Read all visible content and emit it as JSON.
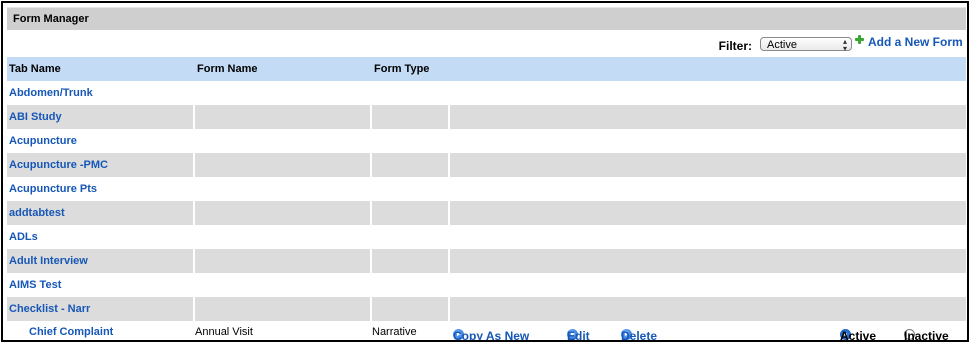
{
  "panel": {
    "title": "Form Manager"
  },
  "filter": {
    "label": "Filter:",
    "selected": "Active",
    "add_label": "Add a New Form"
  },
  "table": {
    "headers": [
      "Tab Name",
      "Form Name",
      "Form Type",
      ""
    ],
    "tabs": [
      "Abdomen/Trunk",
      "ABI Study",
      "Acupuncture",
      "Acupuncture -PMC",
      "Acupuncture Pts",
      "addtabtest",
      "ADLs",
      "Adult Interview",
      "AIMS Test",
      "Checklist - Narr"
    ]
  },
  "form_row": {
    "tab": "Chief Complaint",
    "form_name": "Annual Visit",
    "form_type": "Narrative",
    "copy_label": "Copy As New",
    "edit_label": "Edit",
    "delete_label": "Delete",
    "active_label": "Active",
    "inactive_label": "Inactive",
    "status": "Active"
  }
}
